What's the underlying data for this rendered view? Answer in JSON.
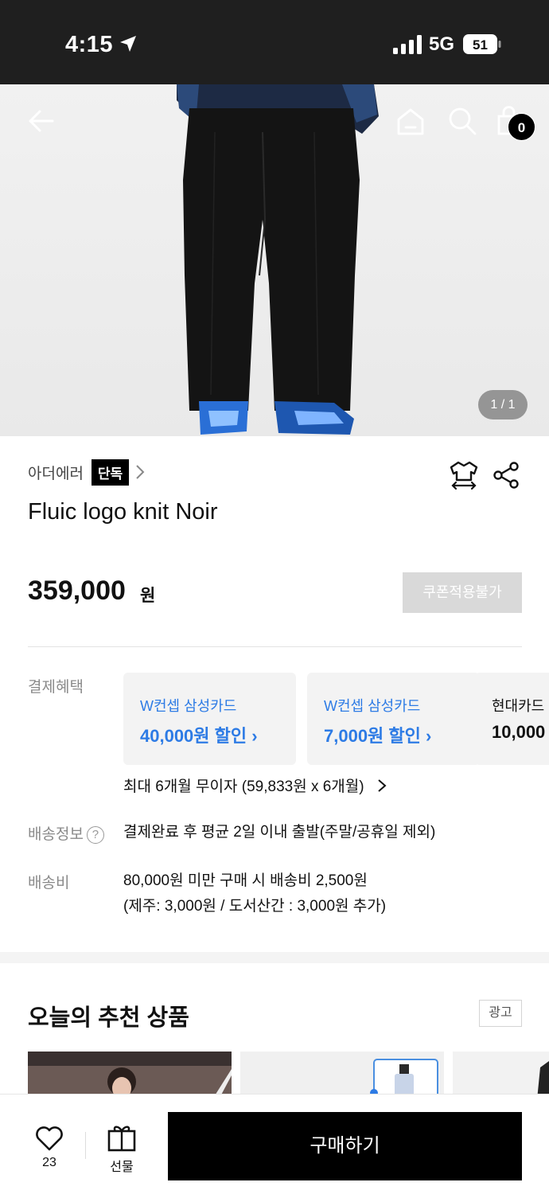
{
  "status_bar": {
    "time": "4:15",
    "network": "5G",
    "battery": "51"
  },
  "header": {
    "icons": [
      "back-arrow-icon",
      "home-icon",
      "search-icon",
      "shopping-bag-icon"
    ],
    "cart_count": "0"
  },
  "gallery": {
    "page_indicator": "1 / 1"
  },
  "product": {
    "brand": "아더에러",
    "exclusive_badge": "단독",
    "title": "Fluic logo knit Noir",
    "price": "359,000",
    "price_unit": "원",
    "coupon_button": "쿠폰적용불가"
  },
  "payment": {
    "label": "결제혜택",
    "cards": [
      {
        "name": "W컨셉 삼성카드",
        "discount": "40,000원 할인"
      },
      {
        "name": "W컨셉 삼성카드",
        "discount": "7,000원 할인"
      },
      {
        "name": "현대카드",
        "discount": "10,000"
      }
    ],
    "installment": "최대 6개월 무이자 (59,833원 x 6개월)"
  },
  "shipping_info": {
    "label": "배송정보",
    "help": "?",
    "text": "결제완료 후 평균 2일 이내 출발(주말/공휴일 제외)"
  },
  "shipping_fee": {
    "label": "배송비",
    "line1": "80,000원 미만 구매 시 배송비 2,500원",
    "line2": "(제주: 3,000원 / 도서산간 : 3,000원 추가)"
  },
  "recommendations": {
    "title": "오늘의 추천 상품",
    "ad_badge": "광고"
  },
  "bottom_bar": {
    "like_count": "23",
    "gift_label": "선물",
    "buy_label": "구매하기"
  },
  "colors": {
    "accent_blue": "#2d7be5",
    "status_bar_bg": "#1f1f1f",
    "buy_button_bg": "#000000",
    "coupon_disabled_bg": "#d9d9d9"
  }
}
